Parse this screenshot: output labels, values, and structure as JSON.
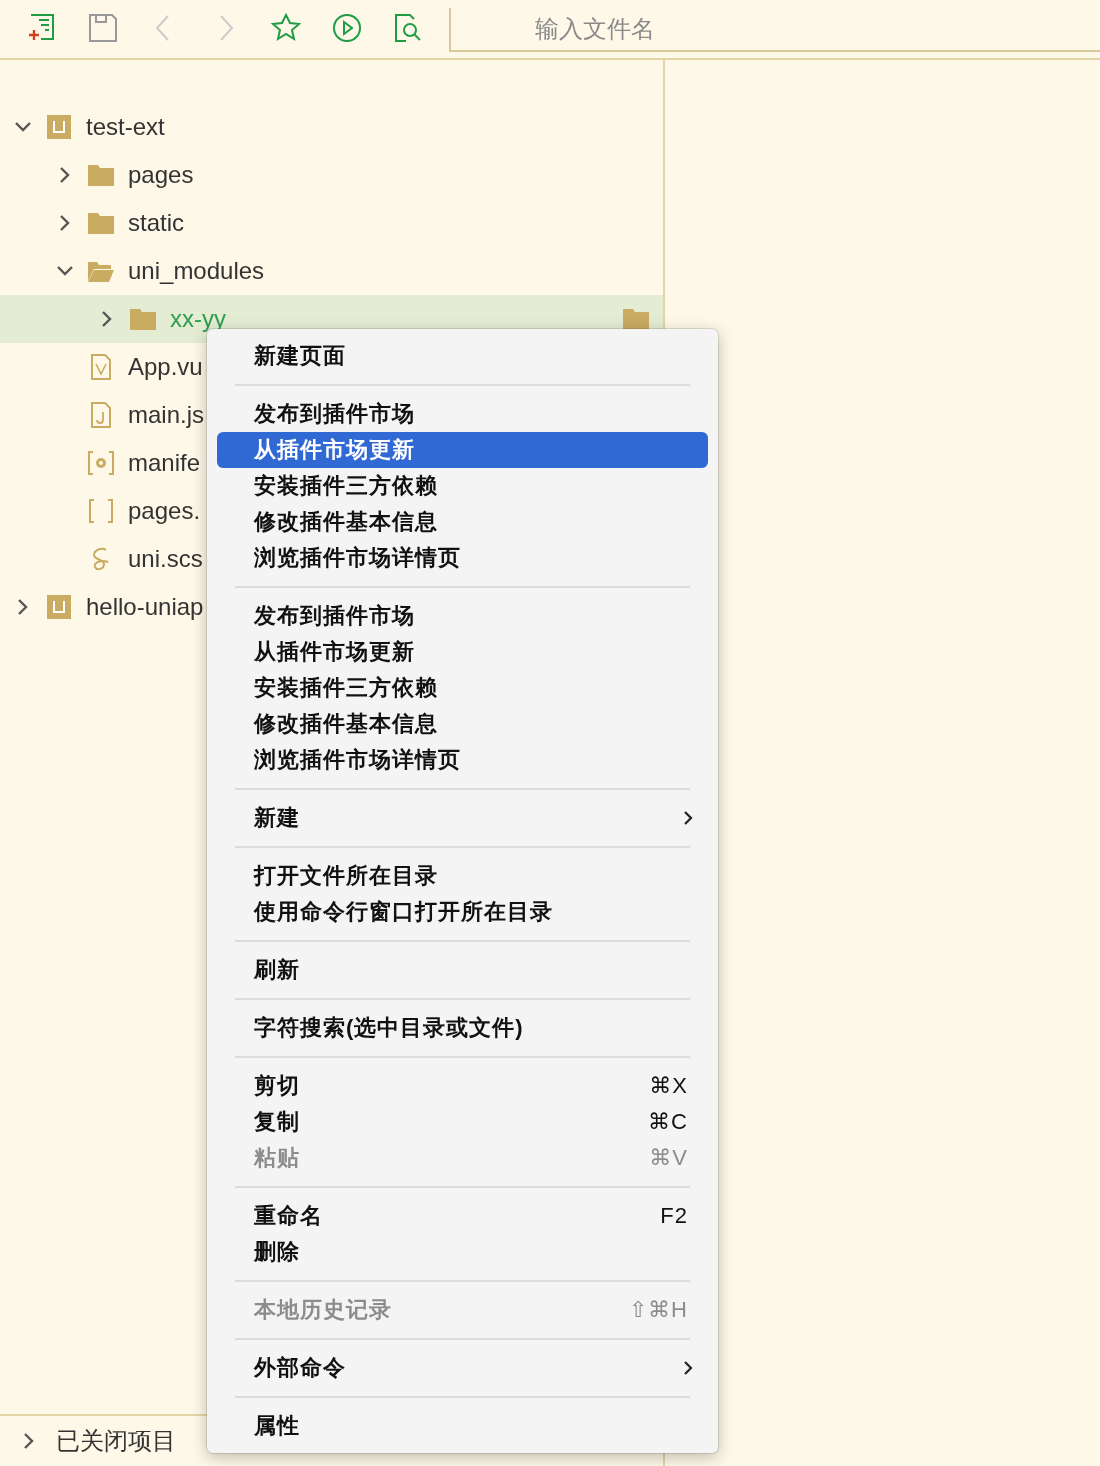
{
  "toolbar": {
    "buttons": [
      {
        "kind": "new-file",
        "disabled": false
      },
      {
        "kind": "save",
        "disabled": false
      },
      {
        "kind": "back",
        "disabled": true
      },
      {
        "kind": "forward",
        "disabled": true
      },
      {
        "kind": "star",
        "disabled": false
      },
      {
        "kind": "run",
        "disabled": false
      },
      {
        "kind": "find-file",
        "disabled": false
      }
    ],
    "search": {
      "placeholder": "输入文件名"
    }
  },
  "tree": [
    {
      "label": "test-ext",
      "kind": "project",
      "expanded": true,
      "selected": false,
      "children": [
        {
          "label": "pages",
          "kind": "folder",
          "expanded": false,
          "selected": false
        },
        {
          "label": "static",
          "kind": "folder",
          "expanded": false,
          "selected": false
        },
        {
          "label": "uni_modules",
          "kind": "folder",
          "expanded": true,
          "selected": false,
          "children": [
            {
              "label": "xx-yy",
              "kind": "folder",
              "expanded": false,
              "selected": true
            }
          ]
        },
        {
          "label": "App.vu",
          "kind": "vue"
        },
        {
          "label": "main.js",
          "kind": "js"
        },
        {
          "label": "manife",
          "kind": "config"
        },
        {
          "label": "pages.",
          "kind": "brackets"
        },
        {
          "label": "uni.scs",
          "kind": "sass"
        }
      ]
    },
    {
      "label": "hello-uniap",
      "kind": "project",
      "expanded": false,
      "selected": false
    }
  ],
  "closed_projects": {
    "label": "已关闭项目",
    "expanded": false
  },
  "context_menu": {
    "groups": [
      [
        {
          "label": "新建页面",
          "selected": false,
          "disabled": false
        }
      ],
      [
        {
          "label": "发布到插件市场",
          "selected": false,
          "disabled": false
        },
        {
          "label": "从插件市场更新",
          "selected": true,
          "disabled": false
        },
        {
          "label": "安装插件三方依赖",
          "selected": false,
          "disabled": false
        },
        {
          "label": "修改插件基本信息",
          "selected": false,
          "disabled": false
        },
        {
          "label": "浏览插件市场详情页",
          "selected": false,
          "disabled": false
        }
      ],
      [
        {
          "label": "发布到插件市场",
          "selected": false,
          "disabled": false
        },
        {
          "label": "从插件市场更新",
          "selected": false,
          "disabled": false
        },
        {
          "label": "安装插件三方依赖",
          "selected": false,
          "disabled": false
        },
        {
          "label": "修改插件基本信息",
          "selected": false,
          "disabled": false
        },
        {
          "label": "浏览插件市场详情页",
          "selected": false,
          "disabled": false
        }
      ],
      [
        {
          "label": "新建",
          "selected": false,
          "disabled": false,
          "submenu": true
        }
      ],
      [
        {
          "label": "打开文件所在目录",
          "selected": false,
          "disabled": false
        },
        {
          "label": "使用命令行窗口打开所在目录",
          "selected": false,
          "disabled": false
        }
      ],
      [
        {
          "label": "刷新",
          "selected": false,
          "disabled": false
        }
      ],
      [
        {
          "label": "字符搜索(选中目录或文件)",
          "selected": false,
          "disabled": false
        }
      ],
      [
        {
          "label": "剪切",
          "shortcut": "⌘X",
          "selected": false,
          "disabled": false
        },
        {
          "label": "复制",
          "shortcut": "⌘C",
          "selected": false,
          "disabled": false
        },
        {
          "label": "粘贴",
          "shortcut": "⌘V",
          "selected": false,
          "disabled": true
        }
      ],
      [
        {
          "label": "重命名",
          "shortcut": "F2",
          "selected": false,
          "disabled": false
        },
        {
          "label": "删除",
          "selected": false,
          "disabled": false
        }
      ],
      [
        {
          "label": "本地历史记录",
          "shortcut": "⇧⌘H",
          "selected": false,
          "disabled": true
        }
      ],
      [
        {
          "label": "外部命令",
          "selected": false,
          "disabled": false,
          "submenu": true
        }
      ],
      [
        {
          "label": "属性",
          "selected": false,
          "disabled": false
        }
      ]
    ]
  }
}
